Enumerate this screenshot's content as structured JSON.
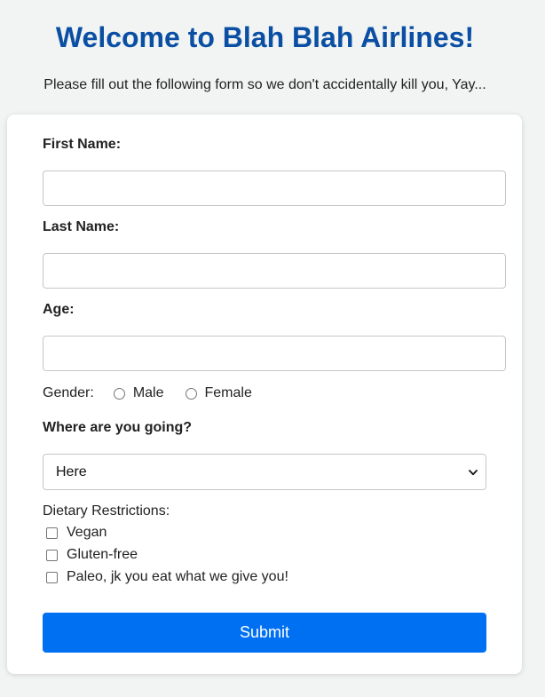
{
  "header": {
    "title": "Welcome to Blah Blah Airlines!",
    "intro": "Please fill out the following form so we don't accidentally kill you, Yay..."
  },
  "form": {
    "first_name": {
      "label": "First Name:",
      "value": "",
      "placeholder": ""
    },
    "last_name": {
      "label": "Last Name:",
      "value": "",
      "placeholder": ""
    },
    "age": {
      "label": "Age:",
      "value": "",
      "placeholder": ""
    },
    "gender": {
      "label": "Gender:",
      "options": [
        "Male",
        "Female"
      ],
      "selected": null
    },
    "destination": {
      "label": "Where are you going?",
      "selected": "Here",
      "icon": "chevron-down-icon"
    },
    "dietary": {
      "label": "Dietary Restrictions:",
      "options": [
        "Vegan",
        "Gluten-free",
        "Paleo, jk you eat what we give you!"
      ],
      "checked": [
        false,
        false,
        false
      ]
    },
    "submit_label": "Submit"
  },
  "colors": {
    "page_background": "#f1f4f3",
    "title": "#0a4fa3",
    "submit_button": "#0070f3",
    "card": "#ffffff"
  }
}
